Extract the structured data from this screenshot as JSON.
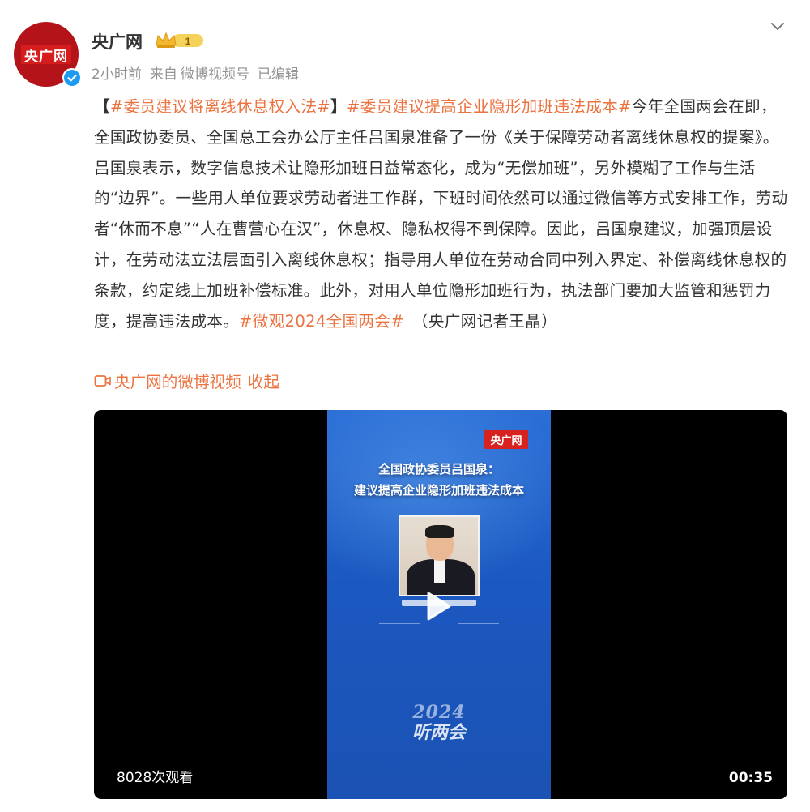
{
  "author": {
    "name": "央广网",
    "avatar_text": "央广网",
    "level": "1",
    "verified": true
  },
  "meta": {
    "time": "2小时前",
    "source_prefix": "来自",
    "source": "微博视频号",
    "edited": "已编辑"
  },
  "post": {
    "bracket_open": "【",
    "tag1": "#委员建议将离线休息权入法#",
    "bracket_close": "】",
    "tag2": "#委员建议提高企业隐形加班违法成本#",
    "text1": "今年全国两会在即，全国政协委员、全国总工会办公厅主任吕国泉准备了一份《关于保障劳动者离线休息权的提案》。吕国泉表示，数字信息技术让隐形加班日益常态化，成为“无偿加班”，另外模糊了工作与生活的“边界”。一些用人单位要求劳动者进工作群，下班时间依然可以通过微信等方式安排工作，劳动者“休而不息”“人在曹营心在汉”，休息权、隐私权得不到保障。因此，吕国泉建议，加强顶层设计，在劳动法立法层面引入离线休息权；指导用人单位在劳动合同中列入界定、补偿离线休息权的条款，约定线上加班补偿标准。此外，对用人单位隐形加班行为，执法部门要加大监管和惩罚力度，提高违法成本。",
    "tag3": "#微观2024全国两会#",
    "credit": "（央广网记者王晶）",
    "video_link": "央广网的微博视频",
    "collapse": "收起"
  },
  "video": {
    "poster_logo": "央广网",
    "title_line1": "全国政协委员吕国泉：",
    "title_line2": "建议提高企业隐形加班违法成本",
    "brand_year": "2024",
    "brand_title": "听两会",
    "views": "8028次观看",
    "duration": "00:35"
  },
  "colors": {
    "accent": "#eb7340",
    "avatar_bg": "#b4131a",
    "verify": "#1d9bf0",
    "video_bg": "#000000",
    "poster_blue": "#1b58c0"
  }
}
